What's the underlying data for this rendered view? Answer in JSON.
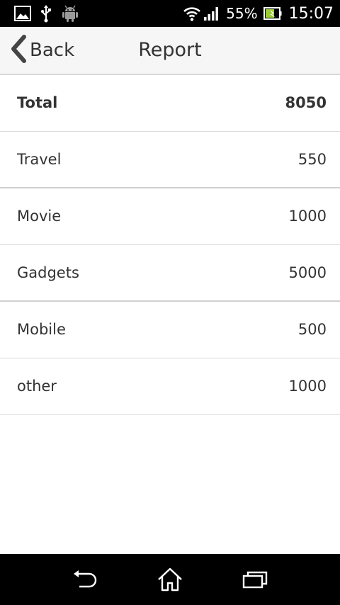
{
  "status_bar": {
    "battery_percent": "55%",
    "time": "15:07",
    "icons": [
      "gallery-icon",
      "usb-icon",
      "android-icon",
      "wifi-icon",
      "signal-icon",
      "battery-icon"
    ]
  },
  "header": {
    "back_label": "Back",
    "title": "Report"
  },
  "report": {
    "rows": [
      {
        "label": "Total",
        "value": "8050"
      },
      {
        "label": "Travel",
        "value": "550"
      },
      {
        "label": "Movie",
        "value": "1000"
      },
      {
        "label": "Gadgets",
        "value": "5000"
      },
      {
        "label": "Mobile",
        "value": "500"
      },
      {
        "label": "other",
        "value": "1000"
      }
    ]
  },
  "nav_bar": {
    "icons": [
      "back-nav-icon",
      "home-icon",
      "recent-apps-icon"
    ]
  },
  "colors": {
    "status_bar_bg": "#000000",
    "title_bar_bg": "#f6f6f6",
    "text": "#333333",
    "divider": "#dcdcdc",
    "battery_charge": "#9acd32"
  }
}
